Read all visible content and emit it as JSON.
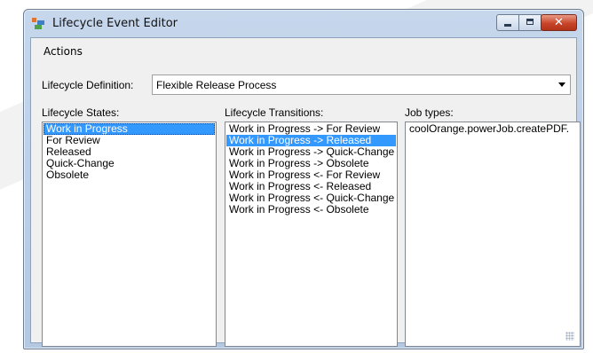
{
  "window": {
    "title": "Lifecycle Event Editor",
    "close_glyph": "✕"
  },
  "menu": {
    "actions_label": "Actions"
  },
  "definition": {
    "label": "Lifecycle Definition:",
    "selected_value": "Flexible Release Process"
  },
  "states": {
    "label": "Lifecycle States:",
    "items": [
      "Work in Progress",
      "For Review",
      "Released",
      "Quick-Change",
      "Obsolete"
    ],
    "selected_index": 0
  },
  "transitions": {
    "label": "Lifecycle Transitions:",
    "items": [
      "Work in Progress -> For Review",
      "Work in Progress -> Released",
      "Work in Progress -> Quick-Change",
      "Work in Progress -> Obsolete",
      "Work in Progress <- For Review",
      "Work in Progress <- Released",
      "Work in Progress <- Quick-Change",
      "Work in Progress <- Obsolete"
    ],
    "selected_index": 1
  },
  "job_types": {
    "label": "Job types:",
    "items": [
      "coolOrange.powerJob.createPDF."
    ]
  },
  "colors": {
    "selection": "#3399ff",
    "close_button": "#c8452a"
  }
}
